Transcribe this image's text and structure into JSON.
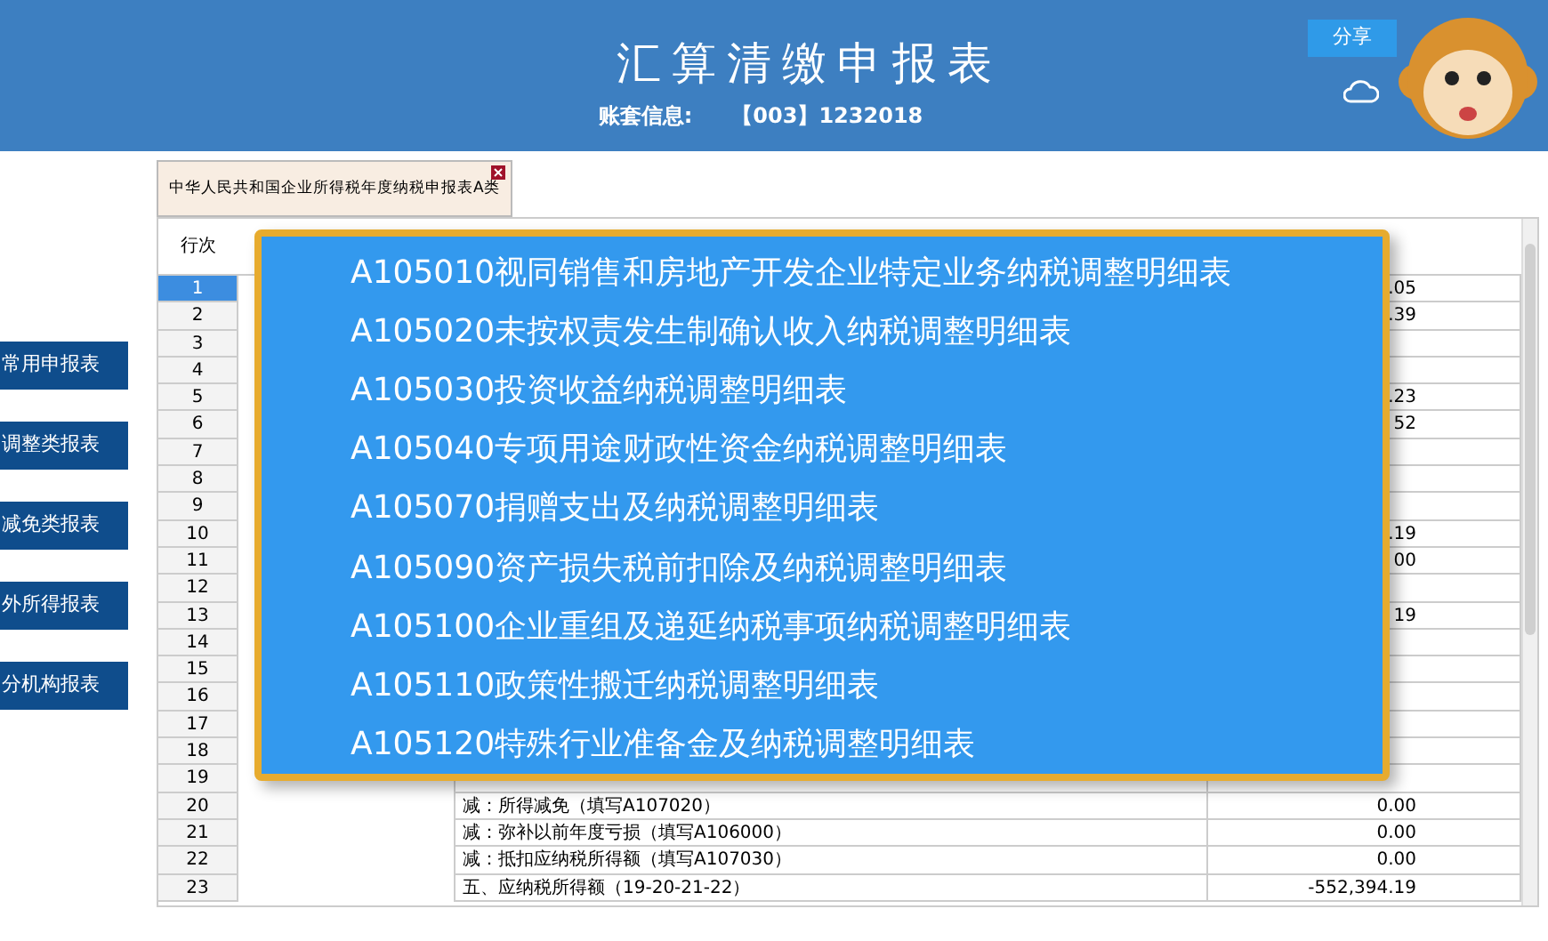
{
  "header": {
    "title": "汇算清缴申报表",
    "account_label": "账套信息:",
    "account_value": "【003】1232018",
    "share_button": "分享"
  },
  "sidebar": {
    "items": [
      {
        "label": "常用申报表"
      },
      {
        "label": "调整类报表"
      },
      {
        "label": "减免类报表"
      },
      {
        "label": "外所得报表"
      },
      {
        "label": "分机构报表"
      }
    ]
  },
  "tabs": [
    {
      "label": "中华人民共和国企业所得税年度纳税申报表A类",
      "selected": true
    }
  ],
  "table": {
    "columns": [
      "行次"
    ],
    "rows": [
      {
        "num": "1",
        "selected": true,
        "amount": ".05"
      },
      {
        "num": "2",
        "selected": false,
        "amount": ".39"
      },
      {
        "num": "3",
        "selected": false
      },
      {
        "num": "4",
        "selected": false
      },
      {
        "num": "5",
        "selected": false,
        "amount": ".23"
      },
      {
        "num": "6",
        "selected": false,
        "amount": "52"
      },
      {
        "num": "7",
        "selected": false
      },
      {
        "num": "8",
        "selected": false
      },
      {
        "num": "9",
        "selected": false
      },
      {
        "num": "10",
        "selected": false,
        "amount": ".19"
      },
      {
        "num": "11",
        "selected": false,
        "amount": "00"
      },
      {
        "num": "12",
        "selected": false
      },
      {
        "num": "13",
        "selected": false,
        "amount": "19"
      },
      {
        "num": "14",
        "selected": false
      },
      {
        "num": "15",
        "selected": false
      },
      {
        "num": "16",
        "selected": false
      },
      {
        "num": "17",
        "selected": false
      },
      {
        "num": "18",
        "selected": false
      },
      {
        "num": "19",
        "selected": false
      },
      {
        "num": "20",
        "selected": false,
        "item": "减：所得减免（填写A107020）",
        "amount": "0.00"
      },
      {
        "num": "21",
        "selected": false,
        "item": "减：弥补以前年度亏损（填写A106000）",
        "amount": "0.00"
      },
      {
        "num": "22",
        "selected": false,
        "item": "减：抵扣应纳税所得额（填写A107030）",
        "amount": "0.00"
      },
      {
        "num": "23",
        "selected": false,
        "item": "五、应纳税所得额（19-20-21-22）",
        "amount": "-552,394.19"
      }
    ]
  },
  "popup": {
    "items": [
      "A105010视同销售和房地产开发企业特定业务纳税调整明细表",
      "A105020未按权责发生制确认收入纳税调整明细表",
      "A105030投资收益纳税调整明细表",
      "A105040专项用途财政性资金纳税调整明细表",
      "A105070捐赠支出及纳税调整明细表",
      "A105090资产损失税前扣除及纳税调整明细表",
      "A105100企业重组及递延纳税事项纳税调整明细表",
      "A105110政策性搬迁纳税调整明细表",
      "A105120特殊行业准备金及纳税调整明细表"
    ]
  }
}
